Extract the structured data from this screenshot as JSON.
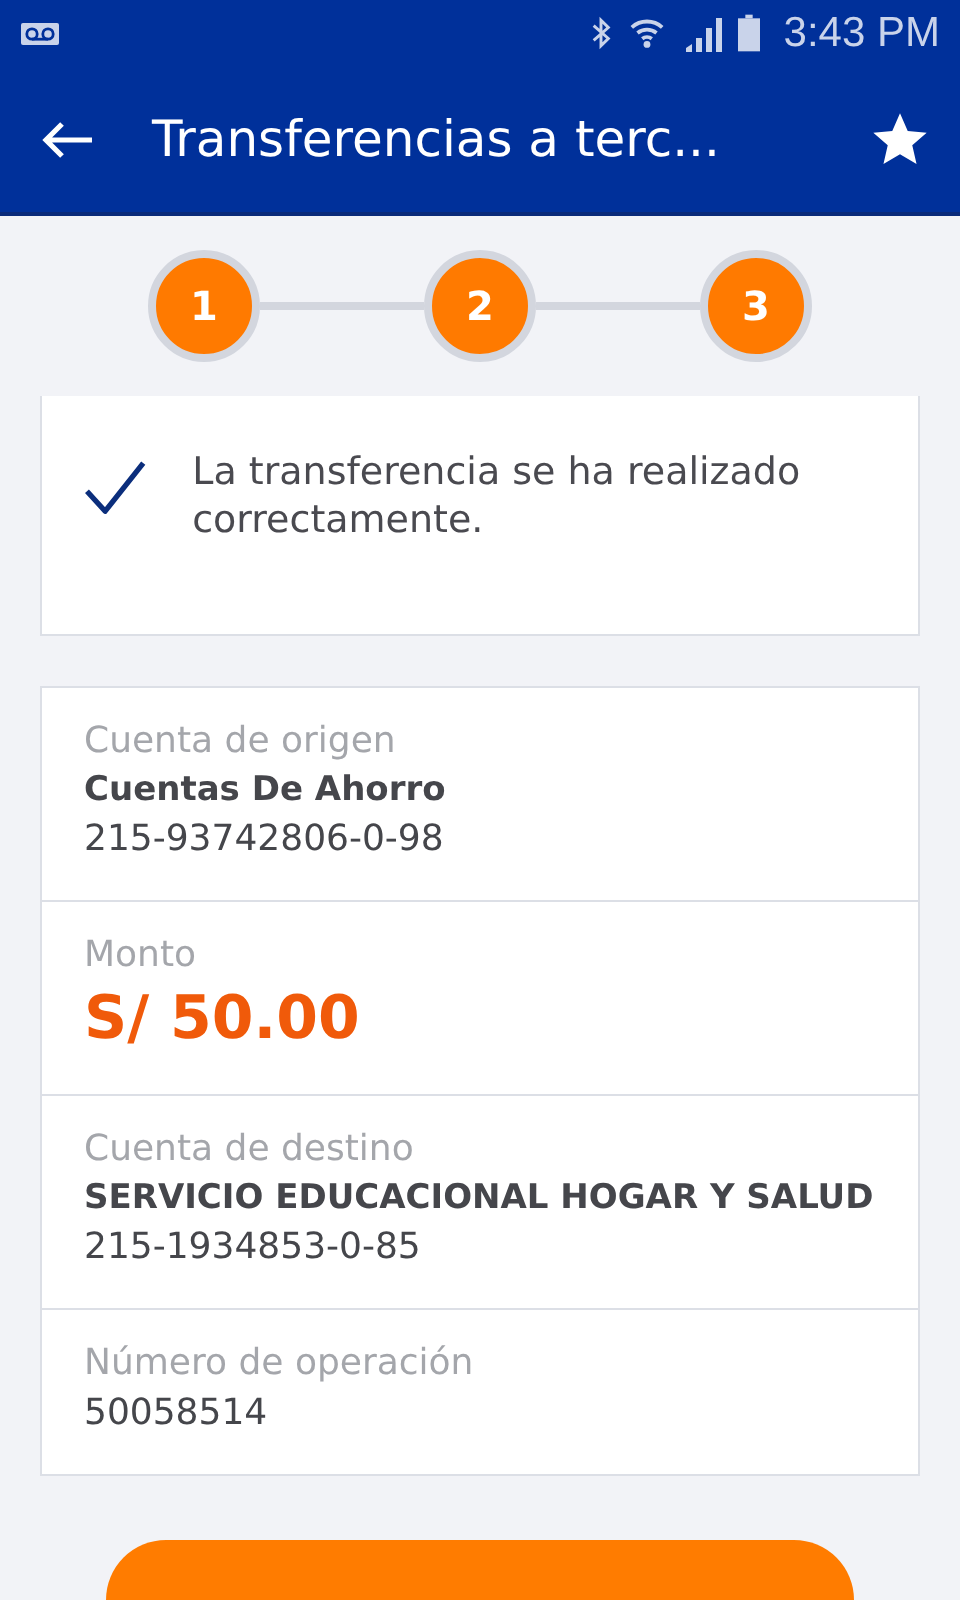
{
  "status_bar": {
    "time": "3:43 PM"
  },
  "app_bar": {
    "title": "Transferencias a terc..."
  },
  "steps": [
    {
      "label": "1",
      "completed": true
    },
    {
      "label": "2",
      "completed": true
    },
    {
      "label": "3",
      "completed": true
    }
  ],
  "message": "La transferencia se ha realizado correctamente.",
  "details": [
    {
      "kind": "account",
      "label": "Cuenta de origen",
      "name": "Cuentas De Ahorro",
      "number": "215-93742806-0-98"
    },
    {
      "kind": "amount",
      "label": "Monto",
      "value": "S/ 50.00"
    },
    {
      "kind": "account",
      "label": "Cuenta de destino",
      "name": "SERVICIO EDUCACIONAL HOGAR Y SALUD",
      "number": "215-1934853-0-85"
    },
    {
      "kind": "value",
      "label": "Número de operación",
      "value": "50058514"
    }
  ]
}
